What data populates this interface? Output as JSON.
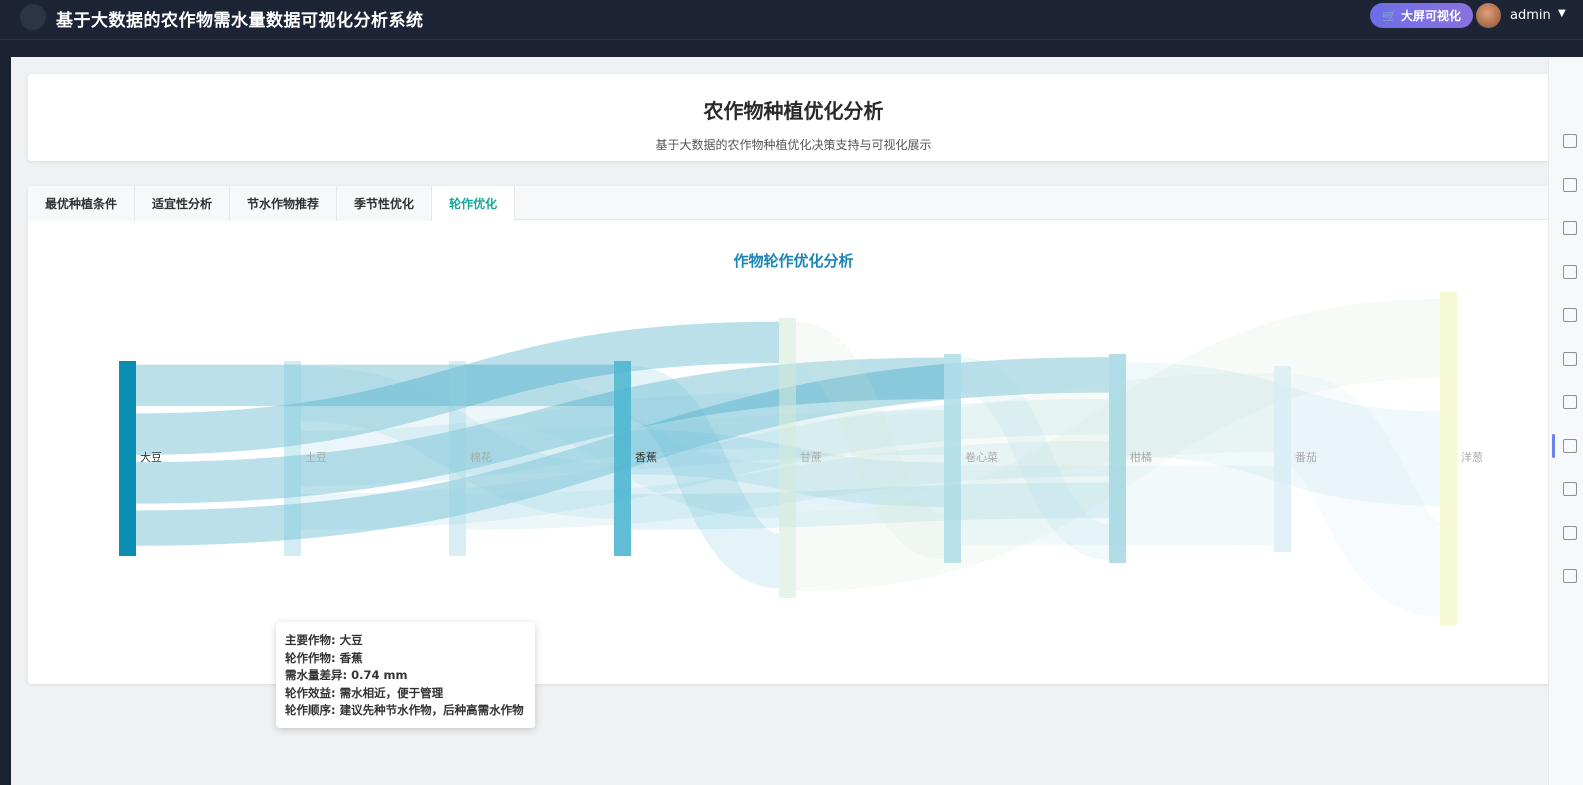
{
  "header": {
    "title": "基于大数据的农作物需水量数据可视化分析系统",
    "bigscreen_label": "大屏可视化",
    "username": "admin"
  },
  "page": {
    "title": "农作物种植优化分析",
    "subtitle": "基于大数据的农作物种植优化决策支持与可视化展示"
  },
  "tabs": [
    {
      "label": "最优种植条件",
      "active": false
    },
    {
      "label": "适宜性分析",
      "active": false
    },
    {
      "label": "节水作物推荐",
      "active": false
    },
    {
      "label": "季节性优化",
      "active": false
    },
    {
      "label": "轮作优化",
      "active": true
    }
  ],
  "chart_data": {
    "type": "sankey",
    "title": "作物轮作优化分析",
    "nodes": [
      "大豆",
      "土豆",
      "棉花",
      "香蕉",
      "甘蔗",
      "卷心菜",
      "柑橘",
      "番茄",
      "洋葱"
    ],
    "links": [
      {
        "source": "大豆",
        "target": "香蕉"
      },
      {
        "source": "大豆",
        "target": "甘蔗"
      },
      {
        "source": "大豆",
        "target": "卷心菜"
      },
      {
        "source": "大豆",
        "target": "柑橘"
      },
      {
        "source": "土豆",
        "target": "香蕉"
      },
      {
        "source": "土豆",
        "target": "甘蔗"
      },
      {
        "source": "土豆",
        "target": "柑橘"
      },
      {
        "source": "棉花",
        "target": "甘蔗"
      },
      {
        "source": "棉花",
        "target": "卷心菜"
      },
      {
        "source": "棉花",
        "target": "柑橘"
      },
      {
        "source": "香蕉",
        "target": "甘蔗"
      },
      {
        "source": "香蕉",
        "target": "卷心菜"
      },
      {
        "source": "香蕉",
        "target": "柑橘"
      },
      {
        "source": "甘蔗",
        "target": "卷心菜"
      },
      {
        "source": "甘蔗",
        "target": "番茄"
      },
      {
        "source": "甘蔗",
        "target": "洋葱"
      },
      {
        "source": "卷心菜",
        "target": "柑橘"
      },
      {
        "source": "卷心菜",
        "target": "番茄"
      },
      {
        "source": "柑橘",
        "target": "洋葱"
      },
      {
        "source": "番茄",
        "target": "洋葱"
      }
    ],
    "colors": [
      "#0a8fb2",
      "#7cc9dc",
      "#8fcfe0",
      "#4fb6d1",
      "#cfe9d6",
      "#a7dbe6",
      "#9cd5e1",
      "#cfe8f2",
      "#f1f8c8"
    ]
  },
  "tooltip": {
    "lines": [
      "主要作物: 大豆",
      "轮作作物: 香蕉",
      "需水量差异: 0.74 mm",
      "轮作效益: 需水相近，便于管理",
      "轮作顺序: 建议先种节水作物，后种高需水作物"
    ]
  },
  "sidebar_icons": [
    "home-icon",
    "user-icon",
    "lock-icon",
    "cart-icon",
    "doc-icon",
    "doc-icon",
    "doc-icon",
    "doc-icon",
    "doc-icon",
    "doc-icon",
    "doc-icon"
  ]
}
